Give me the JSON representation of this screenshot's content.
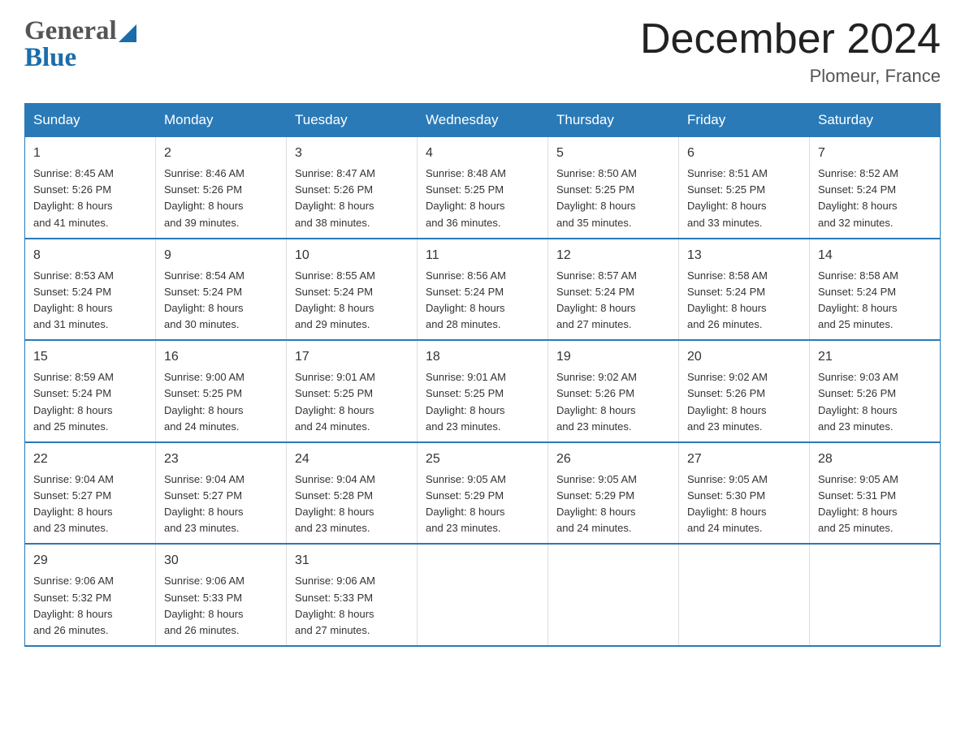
{
  "header": {
    "title": "December 2024",
    "subtitle": "Plomeur, France",
    "logo_general": "General",
    "logo_blue": "Blue"
  },
  "days_of_week": [
    "Sunday",
    "Monday",
    "Tuesday",
    "Wednesday",
    "Thursday",
    "Friday",
    "Saturday"
  ],
  "weeks": [
    [
      {
        "day": "1",
        "sunrise": "8:45 AM",
        "sunset": "5:26 PM",
        "daylight": "8 hours and 41 minutes."
      },
      {
        "day": "2",
        "sunrise": "8:46 AM",
        "sunset": "5:26 PM",
        "daylight": "8 hours and 39 minutes."
      },
      {
        "day": "3",
        "sunrise": "8:47 AM",
        "sunset": "5:26 PM",
        "daylight": "8 hours and 38 minutes."
      },
      {
        "day": "4",
        "sunrise": "8:48 AM",
        "sunset": "5:25 PM",
        "daylight": "8 hours and 36 minutes."
      },
      {
        "day": "5",
        "sunrise": "8:50 AM",
        "sunset": "5:25 PM",
        "daylight": "8 hours and 35 minutes."
      },
      {
        "day": "6",
        "sunrise": "8:51 AM",
        "sunset": "5:25 PM",
        "daylight": "8 hours and 33 minutes."
      },
      {
        "day": "7",
        "sunrise": "8:52 AM",
        "sunset": "5:24 PM",
        "daylight": "8 hours and 32 minutes."
      }
    ],
    [
      {
        "day": "8",
        "sunrise": "8:53 AM",
        "sunset": "5:24 PM",
        "daylight": "8 hours and 31 minutes."
      },
      {
        "day": "9",
        "sunrise": "8:54 AM",
        "sunset": "5:24 PM",
        "daylight": "8 hours and 30 minutes."
      },
      {
        "day": "10",
        "sunrise": "8:55 AM",
        "sunset": "5:24 PM",
        "daylight": "8 hours and 29 minutes."
      },
      {
        "day": "11",
        "sunrise": "8:56 AM",
        "sunset": "5:24 PM",
        "daylight": "8 hours and 28 minutes."
      },
      {
        "day": "12",
        "sunrise": "8:57 AM",
        "sunset": "5:24 PM",
        "daylight": "8 hours and 27 minutes."
      },
      {
        "day": "13",
        "sunrise": "8:58 AM",
        "sunset": "5:24 PM",
        "daylight": "8 hours and 26 minutes."
      },
      {
        "day": "14",
        "sunrise": "8:58 AM",
        "sunset": "5:24 PM",
        "daylight": "8 hours and 25 minutes."
      }
    ],
    [
      {
        "day": "15",
        "sunrise": "8:59 AM",
        "sunset": "5:24 PM",
        "daylight": "8 hours and 25 minutes."
      },
      {
        "day": "16",
        "sunrise": "9:00 AM",
        "sunset": "5:25 PM",
        "daylight": "8 hours and 24 minutes."
      },
      {
        "day": "17",
        "sunrise": "9:01 AM",
        "sunset": "5:25 PM",
        "daylight": "8 hours and 24 minutes."
      },
      {
        "day": "18",
        "sunrise": "9:01 AM",
        "sunset": "5:25 PM",
        "daylight": "8 hours and 23 minutes."
      },
      {
        "day": "19",
        "sunrise": "9:02 AM",
        "sunset": "5:26 PM",
        "daylight": "8 hours and 23 minutes."
      },
      {
        "day": "20",
        "sunrise": "9:02 AM",
        "sunset": "5:26 PM",
        "daylight": "8 hours and 23 minutes."
      },
      {
        "day": "21",
        "sunrise": "9:03 AM",
        "sunset": "5:26 PM",
        "daylight": "8 hours and 23 minutes."
      }
    ],
    [
      {
        "day": "22",
        "sunrise": "9:04 AM",
        "sunset": "5:27 PM",
        "daylight": "8 hours and 23 minutes."
      },
      {
        "day": "23",
        "sunrise": "9:04 AM",
        "sunset": "5:27 PM",
        "daylight": "8 hours and 23 minutes."
      },
      {
        "day": "24",
        "sunrise": "9:04 AM",
        "sunset": "5:28 PM",
        "daylight": "8 hours and 23 minutes."
      },
      {
        "day": "25",
        "sunrise": "9:05 AM",
        "sunset": "5:29 PM",
        "daylight": "8 hours and 23 minutes."
      },
      {
        "day": "26",
        "sunrise": "9:05 AM",
        "sunset": "5:29 PM",
        "daylight": "8 hours and 24 minutes."
      },
      {
        "day": "27",
        "sunrise": "9:05 AM",
        "sunset": "5:30 PM",
        "daylight": "8 hours and 24 minutes."
      },
      {
        "day": "28",
        "sunrise": "9:05 AM",
        "sunset": "5:31 PM",
        "daylight": "8 hours and 25 minutes."
      }
    ],
    [
      {
        "day": "29",
        "sunrise": "9:06 AM",
        "sunset": "5:32 PM",
        "daylight": "8 hours and 26 minutes."
      },
      {
        "day": "30",
        "sunrise": "9:06 AM",
        "sunset": "5:33 PM",
        "daylight": "8 hours and 26 minutes."
      },
      {
        "day": "31",
        "sunrise": "9:06 AM",
        "sunset": "5:33 PM",
        "daylight": "8 hours and 27 minutes."
      },
      null,
      null,
      null,
      null
    ]
  ],
  "labels": {
    "sunrise": "Sunrise:",
    "sunset": "Sunset:",
    "daylight": "Daylight:"
  }
}
